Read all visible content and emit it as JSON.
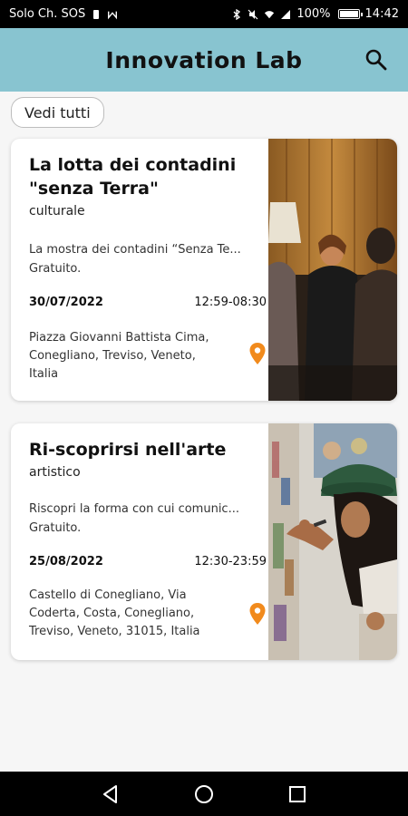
{
  "status_bar": {
    "carrier": "Solo Ch. SOS",
    "battery": "100%",
    "time": "14:42"
  },
  "app_bar": {
    "title": "Innovation Lab",
    "search_icon": "search-icon"
  },
  "filter": {
    "chip_label": "Vedi tutti"
  },
  "events": [
    {
      "title_line1": "La lotta dei contadini",
      "title_line2": "\"senza Terra\"",
      "category": "culturale",
      "description_line1": "La mostra dei contadini “Senza Te...",
      "description_line2": "Gratuito.",
      "date": "30/07/2022",
      "time": "12:59-08:30",
      "address_line1": "Piazza Giovanni Battista Cima,",
      "address_line2": "Conegliano, Treviso, Veneto,",
      "address_line3": "Italia",
      "location_icon": "location-pin-icon"
    },
    {
      "title_line1": "Ri-scoprirsi nell'arte",
      "category": "artistico",
      "description_line1": "Riscopri la forma con cui comunic...",
      "description_line2": "Gratuito.",
      "date": "25/08/2022",
      "time": "12:30-23:59",
      "address_line1": "Castello di Conegliano, Via",
      "address_line2": "Coderta, Costa, Conegliano,",
      "address_line3": "Treviso, Veneto, 31015, Italia",
      "location_icon": "location-pin-icon"
    }
  ],
  "colors": {
    "app_bar": "#88c4d0",
    "pin": "#f18a1c",
    "background": "#f6f6f6"
  }
}
